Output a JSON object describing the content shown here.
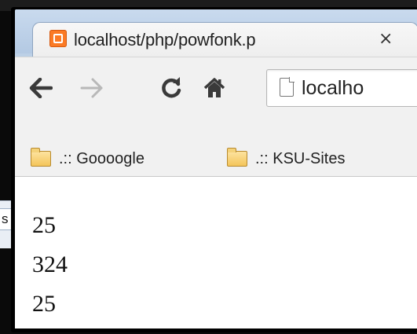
{
  "background_window": {
    "field_text": "s"
  },
  "tab": {
    "title": "localhost/php/powfonk.p",
    "close_glyph": "×",
    "favicon": "xampp-icon"
  },
  "toolbar": {
    "back_icon": "back-arrow-icon",
    "forward_icon": "forward-arrow-icon",
    "reload_icon": "reload-icon",
    "home_icon": "home-icon",
    "url": "localho"
  },
  "bookmarks": [
    {
      "label": ".:: Goooogle",
      "icon": "folder-icon"
    },
    {
      "label": ".:: KSU-Sites",
      "icon": "folder-icon"
    }
  ],
  "page": {
    "lines": [
      "25",
      "324",
      "25"
    ]
  },
  "colors": {
    "tab_strip": "#bcd0e6",
    "favicon": "#fb7a24",
    "folder": "#f4c55a"
  }
}
